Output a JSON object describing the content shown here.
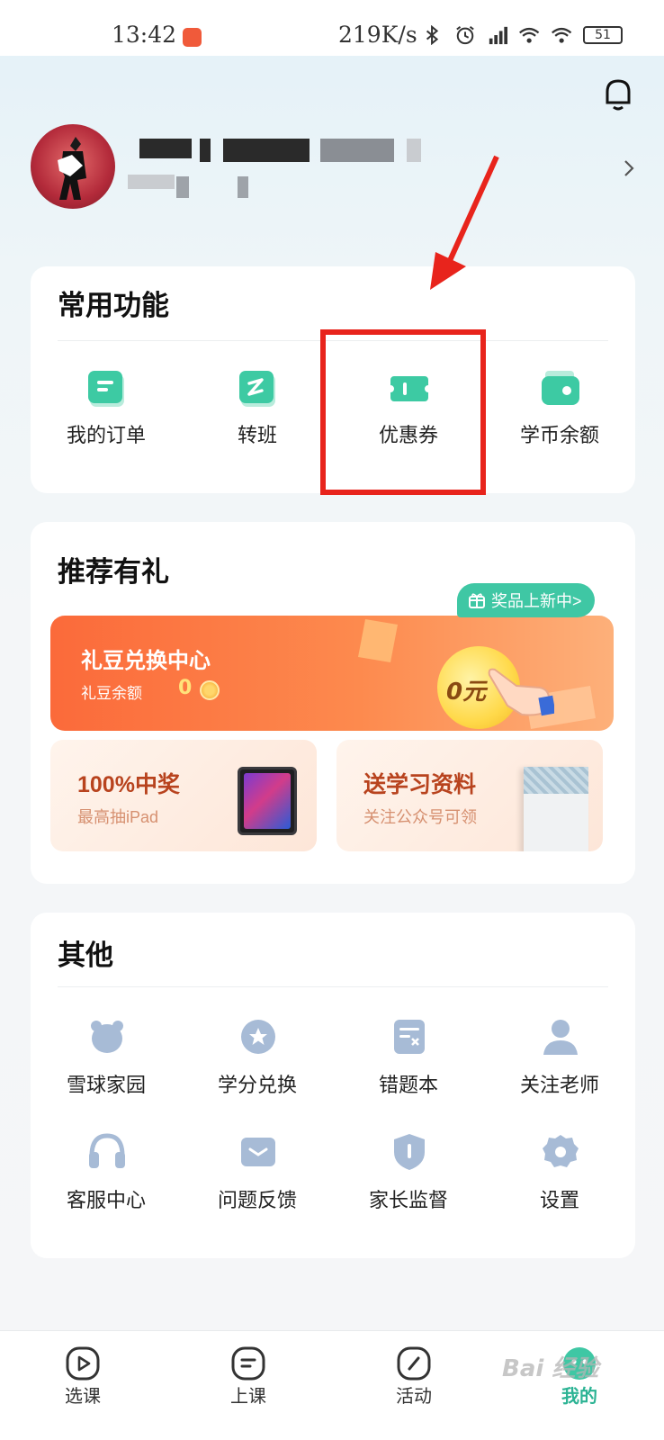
{
  "status_bar": {
    "time": "13:42",
    "speed": "219K/s",
    "battery": "51"
  },
  "sections": {
    "common": {
      "title": "常用功能",
      "items": [
        {
          "label": "我的订单",
          "icon": "order-icon"
        },
        {
          "label": "转班",
          "icon": "transfer-class-icon"
        },
        {
          "label": "优惠券",
          "icon": "coupon-icon"
        },
        {
          "label": "学币余额",
          "icon": "wallet-icon"
        }
      ]
    },
    "recommend": {
      "title": "推荐有礼",
      "badge": "奖品上新中>",
      "exchange": {
        "title": "礼豆兑换中心",
        "sub": "礼豆余额",
        "balance": "0",
        "coin_text": "0元"
      },
      "cards": [
        {
          "title": "100%中奖",
          "sub": "最高抽iPad"
        },
        {
          "title": "送学习资料",
          "sub": "关注公众号可领"
        }
      ]
    },
    "other": {
      "title": "其他",
      "items": [
        {
          "label": "雪球家园",
          "icon": "snowball-home-icon"
        },
        {
          "label": "学分兑换",
          "icon": "credit-exchange-icon"
        },
        {
          "label": "错题本",
          "icon": "mistake-book-icon"
        },
        {
          "label": "关注老师",
          "icon": "follow-teacher-icon"
        },
        {
          "label": "客服中心",
          "icon": "customer-service-icon"
        },
        {
          "label": "问题反馈",
          "icon": "feedback-icon"
        },
        {
          "label": "家长监督",
          "icon": "parent-supervision-icon"
        },
        {
          "label": "设置",
          "icon": "settings-icon"
        }
      ]
    }
  },
  "tabbar": {
    "tabs": [
      {
        "label": "选课",
        "icon": "play-circle-icon"
      },
      {
        "label": "上课",
        "icon": "class-icon"
      },
      {
        "label": "活动",
        "icon": "activity-icon"
      },
      {
        "label": "我的",
        "icon": "profile-icon",
        "active": true
      }
    ]
  },
  "colors": {
    "accent": "#3fc7a4",
    "icon_gray": "#a7bbd6",
    "highlight": "#e8241c",
    "orange": "#fb6a3a"
  },
  "watermark": "Bai 经验"
}
